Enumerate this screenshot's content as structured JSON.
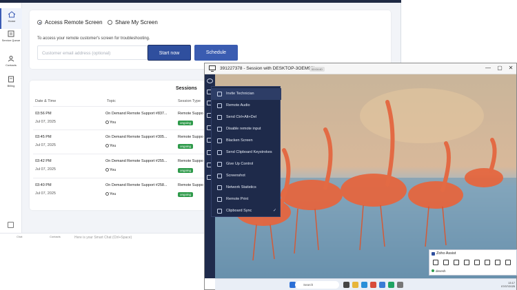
{
  "rail": {
    "items": [
      {
        "label": "Home"
      },
      {
        "label": "Service Queue"
      },
      {
        "label": "Contacts"
      },
      {
        "label": "Billing"
      }
    ]
  },
  "connect": {
    "access_label": "Access Remote Screen",
    "share_label": "Share My Screen",
    "helptext": "To access your remote customer's screen for troubleshooting.",
    "email_placeholder": "Customer email address (optional)",
    "start_label": "Start now",
    "schedule_label": "Schedule"
  },
  "sessions": {
    "title": "Sessions",
    "headers": [
      "Date & Time",
      "Topic",
      "Session Type"
    ],
    "rows": [
      {
        "time": "03:56 PM",
        "date": "Jul 07, 2025",
        "topic": "On Demand Remote Support #837...",
        "owner": "You",
        "type": "Remote Suppo",
        "status": "ongoing"
      },
      {
        "time": "03:45 PM",
        "date": "Jul 07, 2025",
        "topic": "On Demand Remote Support #305...",
        "owner": "You",
        "type": "Remote Suppo",
        "status": "ongoing"
      },
      {
        "time": "03:42 PM",
        "date": "Jul 07, 2025",
        "topic": "On Demand Remote Support #255...",
        "owner": "You",
        "type": "Remote Suppo",
        "status": "ongoing"
      },
      {
        "time": "03:40 PM",
        "date": "Jul 07, 2025",
        "topic": "On Demand Remote Support #258...",
        "owner": "You",
        "type": "Remote Suppo",
        "status": "ongoing"
      }
    ]
  },
  "bottombar": {
    "items": [
      "Chat",
      "Contacts"
    ],
    "chat_placeholder": "Here is your Smart Chat (Ctrl+Space)"
  },
  "session_window": {
    "title": "391227378 - Session with DESKTOP-3OEM98L",
    "tag": "00:04:40",
    "controls": [
      "—",
      "▢",
      "✕"
    ]
  },
  "menu": {
    "items": [
      {
        "label": "Invite Technician",
        "checked": false
      },
      {
        "label": "Remote Audio",
        "checked": false
      },
      {
        "label": "Send Ctrl+Alt+Del",
        "checked": false
      },
      {
        "label": "Disable remote input",
        "checked": false
      },
      {
        "label": "Blacken Screen",
        "checked": false
      },
      {
        "label": "Send Clipboard Keystrokes",
        "checked": false
      },
      {
        "label": "Give Up Control",
        "checked": false
      },
      {
        "label": "Screenshot",
        "checked": false
      },
      {
        "label": "Network Statistics",
        "checked": false
      },
      {
        "label": "Remote Print",
        "checked": false
      },
      {
        "label": "Clipboard Sync",
        "checked": true
      }
    ],
    "check_glyph": "✓"
  },
  "taskbar": {
    "search_placeholder": "Search",
    "clock_time": "13:17",
    "clock_date": "07/07/2025"
  },
  "assist": {
    "title": "Zoho Assist",
    "user": "devesh"
  },
  "colors": {
    "primary": "#2f4f9e",
    "ongoing": "#2e9a4a",
    "menu_bg": "#1e2a4a"
  }
}
